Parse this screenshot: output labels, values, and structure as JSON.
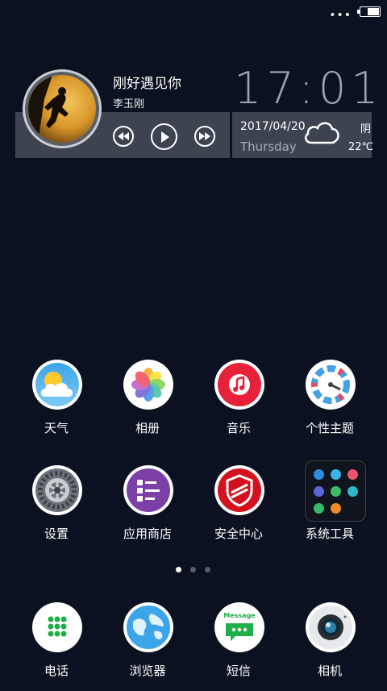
{
  "status_bar": {
    "menu": "•••"
  },
  "music": {
    "title": "刚好遇见你",
    "artist": "李玉刚"
  },
  "clock": {
    "time": "17:01"
  },
  "weather": {
    "date": "2017/04/20",
    "weekday": "Thursday",
    "condition": "阴",
    "temperature": "22℃"
  },
  "apps_row1": [
    {
      "label": "天气"
    },
    {
      "label": "相册"
    },
    {
      "label": "音乐"
    },
    {
      "label": "个性主题"
    }
  ],
  "apps_row2": [
    {
      "label": "设置"
    },
    {
      "label": "应用商店"
    },
    {
      "label": "安全中心"
    },
    {
      "label": "系统工具"
    }
  ],
  "page_indicator": {
    "pages": 3,
    "active": 1
  },
  "dock": [
    {
      "label": "电话"
    },
    {
      "label": "浏览器"
    },
    {
      "label": "短信",
      "icon_text": "Message"
    },
    {
      "label": "相机"
    }
  ]
}
